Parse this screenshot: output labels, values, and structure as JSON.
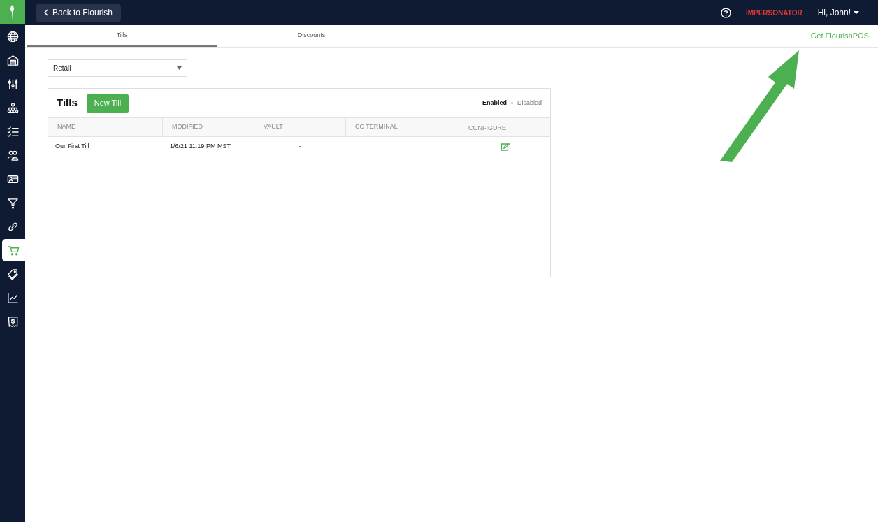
{
  "topbar": {
    "back_button": "Back to Flourish",
    "impersonator": "IMPERSONATOR",
    "user_menu": "Hi, John!"
  },
  "sidebar": {
    "items": [
      {
        "kind": "globe",
        "selected": false
      },
      {
        "kind": "warehouse",
        "selected": false
      },
      {
        "kind": "sliders",
        "selected": false
      },
      {
        "kind": "hierarchy",
        "selected": false
      },
      {
        "kind": "checklist",
        "selected": false
      },
      {
        "kind": "people",
        "selected": false
      },
      {
        "kind": "card",
        "selected": false
      },
      {
        "kind": "funnel",
        "selected": false
      },
      {
        "kind": "link",
        "selected": false
      },
      {
        "kind": "cart",
        "selected": true
      },
      {
        "kind": "tags",
        "selected": false
      },
      {
        "kind": "chart",
        "selected": false
      },
      {
        "kind": "receipt",
        "selected": false
      }
    ]
  },
  "tabs": [
    {
      "label": "Tills",
      "selected": true
    },
    {
      "label": "Discounts",
      "selected": false
    }
  ],
  "promo_link": "Get FlourishPOS!",
  "location_select": {
    "value": "Retail"
  },
  "tills_panel": {
    "title": "Tills",
    "new_button": "New Till",
    "filters": [
      {
        "label": "Enabled",
        "selected": true
      },
      {
        "label": "Disabled",
        "selected": false
      }
    ],
    "columns": [
      "NAME",
      "MODIFIED",
      "VAULT",
      "CC TERMINAL",
      "CONFIGURE"
    ],
    "rows": [
      {
        "name": "Our First Till",
        "modified": "1/6/21 11:19 PM MST",
        "vault": "-",
        "cc_terminal": ""
      }
    ]
  }
}
